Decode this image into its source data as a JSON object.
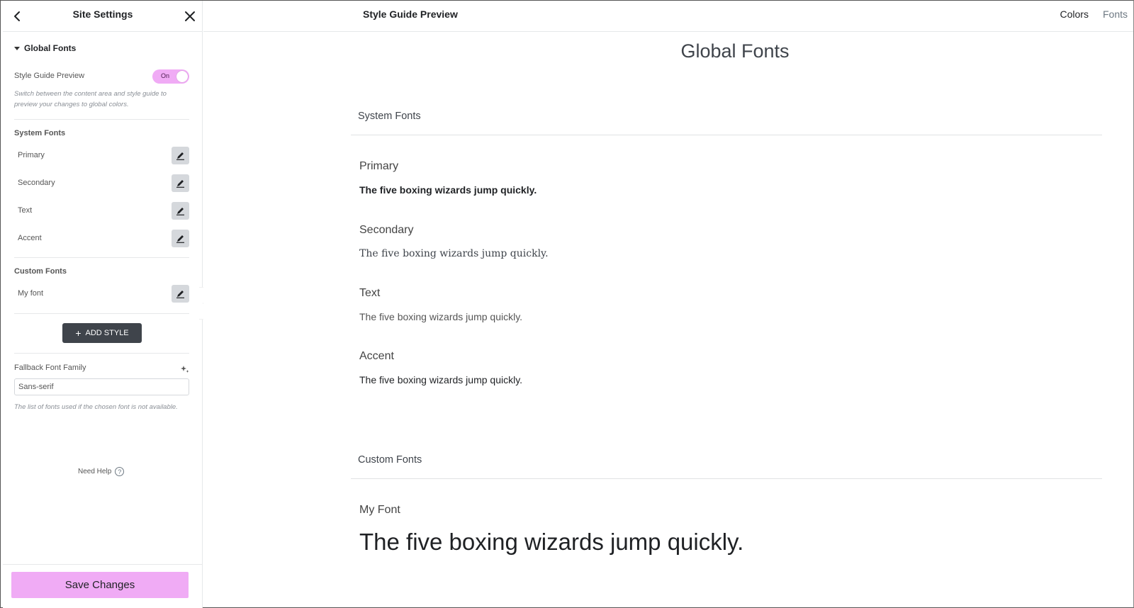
{
  "sidebar": {
    "title": "Site Settings",
    "section_label": "Global Fonts",
    "style_guide_preview": {
      "label": "Style Guide Preview",
      "toggle_text": "On",
      "help": "Switch between the content area and style guide to preview your changes to global colors."
    },
    "system_fonts": {
      "title": "System Fonts",
      "items": [
        {
          "label": "Primary"
        },
        {
          "label": "Secondary"
        },
        {
          "label": "Text"
        },
        {
          "label": "Accent"
        }
      ]
    },
    "custom_fonts": {
      "title": "Custom Fonts",
      "items": [
        {
          "label": "My font"
        }
      ]
    },
    "add_style_label": "ADD STYLE",
    "fallback": {
      "label": "Fallback Font Family",
      "value": "Sans-serif",
      "help": "The list of fonts used if the chosen font is not available."
    },
    "need_help_label": "Need Help",
    "save_label": "Save Changes",
    "accent_color": "#f0abf5"
  },
  "main": {
    "title": "Style Guide Preview",
    "tabs": [
      {
        "label": "Colors"
      },
      {
        "label": "Fonts"
      }
    ],
    "page_title": "Global Fonts",
    "system_section": {
      "title": "System Fonts",
      "items": [
        {
          "label": "Primary",
          "sample": "The five boxing wizards jump quickly."
        },
        {
          "label": "Secondary",
          "sample": "The five boxing wizards jump quickly."
        },
        {
          "label": "Text",
          "sample": "The five boxing wizards jump quickly."
        },
        {
          "label": "Accent",
          "sample": "The five boxing wizards jump quickly."
        }
      ]
    },
    "custom_section": {
      "title": "Custom Fonts",
      "items": [
        {
          "label": "My Font",
          "sample": "The five boxing wizards jump quickly."
        }
      ]
    }
  }
}
